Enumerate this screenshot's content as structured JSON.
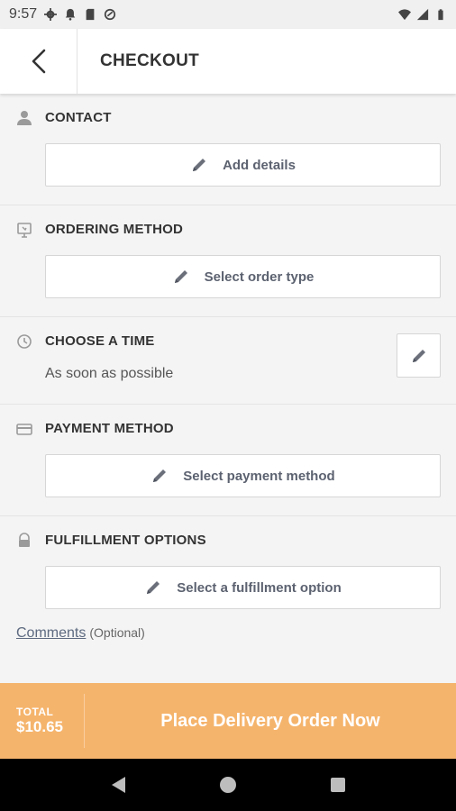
{
  "status_bar": {
    "time": "9:57"
  },
  "header": {
    "title": "CHECKOUT"
  },
  "sections": {
    "contact": {
      "title": "CONTACT",
      "button_label": "Add details"
    },
    "ordering": {
      "title": "ORDERING METHOD",
      "button_label": "Select order type"
    },
    "time": {
      "title": "CHOOSE A TIME",
      "value": "As soon as possible"
    },
    "payment": {
      "title": "PAYMENT METHOD",
      "button_label": "Select payment method"
    },
    "fulfillment": {
      "title": "FULFILLMENT OPTIONS",
      "button_label": "Select a fulfillment option"
    }
  },
  "comments": {
    "link_label": "Comments",
    "optional_label": "(Optional)"
  },
  "footer": {
    "total_label": "TOTAL",
    "total_amount": "$10.65",
    "action_label": "Place Delivery Order Now"
  },
  "colors": {
    "accent": "#f5b46c",
    "button_text": "#5c6270",
    "link": "#5d6a80"
  }
}
